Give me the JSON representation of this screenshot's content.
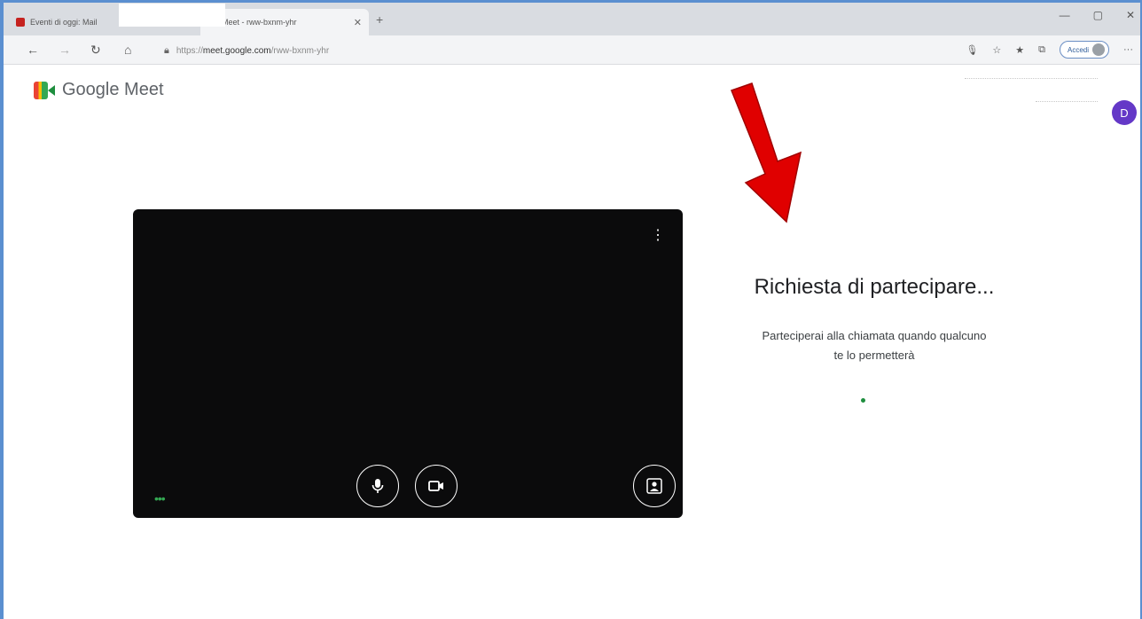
{
  "browser": {
    "tabs": [
      {
        "title": "Eventi di oggi: Mail",
        "favicon": "mail-icon",
        "active": false
      },
      {
        "title": "Meet - rww-bxnm-yhr",
        "favicon": "meet-icon",
        "active": true
      }
    ],
    "new_tab": "+",
    "window_controls": [
      "—",
      "▢",
      "✕"
    ],
    "url": {
      "scheme": "https://",
      "host": "meet.google.com",
      "path": "/rww-bxnm-yhr"
    },
    "login_label": "Accedi",
    "more": "···"
  },
  "meet": {
    "app_name": "Google Meet",
    "user_initial": "D",
    "status_title": "Richiesta di partecipare...",
    "status_line1": "Parteciperai alla chiamata quando qualcuno",
    "status_line2": "te lo permetterà",
    "preview_more": "⋮",
    "preview_dots": "•••"
  },
  "colors": {
    "avatar": "#6438c7",
    "preview_bg": "#0b0b0c",
    "arrow": "#e00000",
    "frame": "#5b8fd0"
  }
}
